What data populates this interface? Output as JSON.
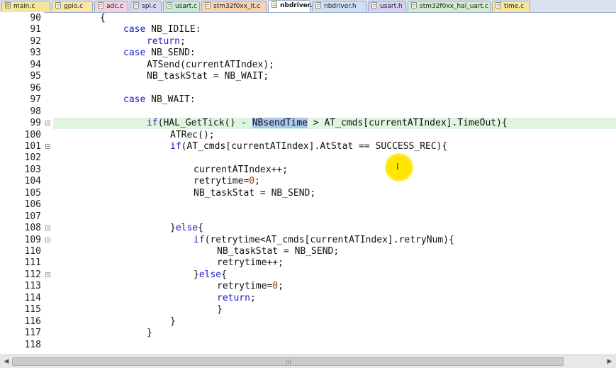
{
  "tabs": [
    {
      "label": "main.c",
      "color": "#f5e79a",
      "icon": "file-icon-locked"
    },
    {
      "label": "gpio.c",
      "color": "#fde7a8",
      "icon": "file-icon"
    },
    {
      "label": "adc.c",
      "color": "#f5cfe0",
      "icon": "file-icon"
    },
    {
      "label": "spi.c",
      "color": "#d9d6f2",
      "icon": "file-icon"
    },
    {
      "label": "usart.c",
      "color": "#c9ebd2",
      "icon": "file-icon"
    },
    {
      "label": "stm32f0xx_it.c",
      "color": "#f7d3b4",
      "icon": "file-icon"
    },
    {
      "label": "nbdriver.c",
      "color": "#ffffff",
      "icon": "file-icon",
      "active": true
    },
    {
      "label": "nbdriver.h",
      "color": "#cddff5",
      "icon": "file-icon"
    },
    {
      "label": "usart.h",
      "color": "#d7d0f2",
      "icon": "file-icon"
    },
    {
      "label": "stm32f0xx_hal_uart.c",
      "color": "#d2ecd0",
      "icon": "file-icon"
    },
    {
      "label": "time.c",
      "color": "#f6e6a0",
      "icon": "file-icon"
    }
  ],
  "code": {
    "current_line": "99",
    "lines": [
      {
        "n": "90",
        "indent": 2,
        "parts": [
          {
            "t": "{"
          }
        ]
      },
      {
        "n": "91",
        "indent": 3,
        "parts": [
          {
            "t": "case",
            "c": "kw"
          },
          {
            "t": " NB_IDILE:"
          }
        ]
      },
      {
        "n": "92",
        "indent": 4,
        "parts": [
          {
            "t": "return",
            "c": "kw"
          },
          {
            "t": ";"
          }
        ]
      },
      {
        "n": "93",
        "indent": 3,
        "parts": [
          {
            "t": "case",
            "c": "kw"
          },
          {
            "t": " NB_SEND:"
          }
        ]
      },
      {
        "n": "94",
        "indent": 4,
        "parts": [
          {
            "t": "ATSend(currentATIndex);"
          }
        ]
      },
      {
        "n": "95",
        "indent": 4,
        "parts": [
          {
            "t": "NB_taskStat = NB_WAIT;"
          }
        ]
      },
      {
        "n": "96",
        "indent": 0,
        "parts": []
      },
      {
        "n": "97",
        "indent": 3,
        "parts": [
          {
            "t": "case",
            "c": "kw"
          },
          {
            "t": " NB_WAIT:"
          }
        ]
      },
      {
        "n": "98",
        "indent": 0,
        "parts": []
      },
      {
        "n": "99",
        "indent": 4,
        "parts": [
          {
            "t": "if",
            "c": "kw"
          },
          {
            "t": "(HAL_GetTick() - "
          },
          {
            "t": "NBsendTime",
            "c": "hl"
          },
          {
            "t": " > AT_cmds[currentATIndex].TimeOut){"
          }
        ]
      },
      {
        "n": "100",
        "indent": 5,
        "parts": [
          {
            "t": "ATRec();"
          }
        ]
      },
      {
        "n": "101",
        "indent": 5,
        "parts": [
          {
            "t": "if",
            "c": "kw"
          },
          {
            "t": "(AT_cmds[currentATIndex].AtStat == SUCCESS_REC){"
          }
        ]
      },
      {
        "n": "102",
        "indent": 0,
        "parts": []
      },
      {
        "n": "103",
        "indent": 6,
        "parts": [
          {
            "t": "currentATIndex++;"
          }
        ]
      },
      {
        "n": "104",
        "indent": 6,
        "parts": [
          {
            "t": "retrytime="
          },
          {
            "t": "0",
            "c": "num"
          },
          {
            "t": ";"
          }
        ]
      },
      {
        "n": "105",
        "indent": 6,
        "parts": [
          {
            "t": "NB_taskStat = NB_SEND;"
          }
        ]
      },
      {
        "n": "106",
        "indent": 0,
        "parts": []
      },
      {
        "n": "107",
        "indent": 0,
        "parts": []
      },
      {
        "n": "108",
        "indent": 5,
        "parts": [
          {
            "t": "}"
          },
          {
            "t": "else",
            "c": "kw"
          },
          {
            "t": "{"
          }
        ]
      },
      {
        "n": "109",
        "indent": 6,
        "parts": [
          {
            "t": "if",
            "c": "kw"
          },
          {
            "t": "(retrytime<AT_cmds[currentATIndex].retryNum){"
          }
        ]
      },
      {
        "n": "110",
        "indent": 7,
        "parts": [
          {
            "t": "NB_taskStat = NB_SEND;"
          }
        ]
      },
      {
        "n": "111",
        "indent": 7,
        "parts": [
          {
            "t": "retrytime++;"
          }
        ]
      },
      {
        "n": "112",
        "indent": 6,
        "parts": [
          {
            "t": "}"
          },
          {
            "t": "else",
            "c": "kw"
          },
          {
            "t": "{"
          }
        ]
      },
      {
        "n": "113",
        "indent": 7,
        "parts": [
          {
            "t": "retrytime="
          },
          {
            "t": "0",
            "c": "num"
          },
          {
            "t": ";"
          }
        ]
      },
      {
        "n": "114",
        "indent": 7,
        "parts": [
          {
            "t": "return",
            "c": "kw"
          },
          {
            "t": ";"
          }
        ]
      },
      {
        "n": "115",
        "indent": 7,
        "parts": [
          {
            "t": "}"
          }
        ]
      },
      {
        "n": "116",
        "indent": 5,
        "parts": [
          {
            "t": "}"
          }
        ]
      },
      {
        "n": "117",
        "indent": 4,
        "parts": [
          {
            "t": "}"
          }
        ]
      },
      {
        "n": "118",
        "indent": 0,
        "parts": []
      }
    ]
  },
  "colors": {
    "keyword": "#1a1ac8",
    "number": "#b8320b",
    "current_line_bg": "#dff5df",
    "selection": "#a9c8ec",
    "cursor_highlight": "#ffe600"
  },
  "scrollbar": {
    "grip_icon": "grip-icon"
  }
}
